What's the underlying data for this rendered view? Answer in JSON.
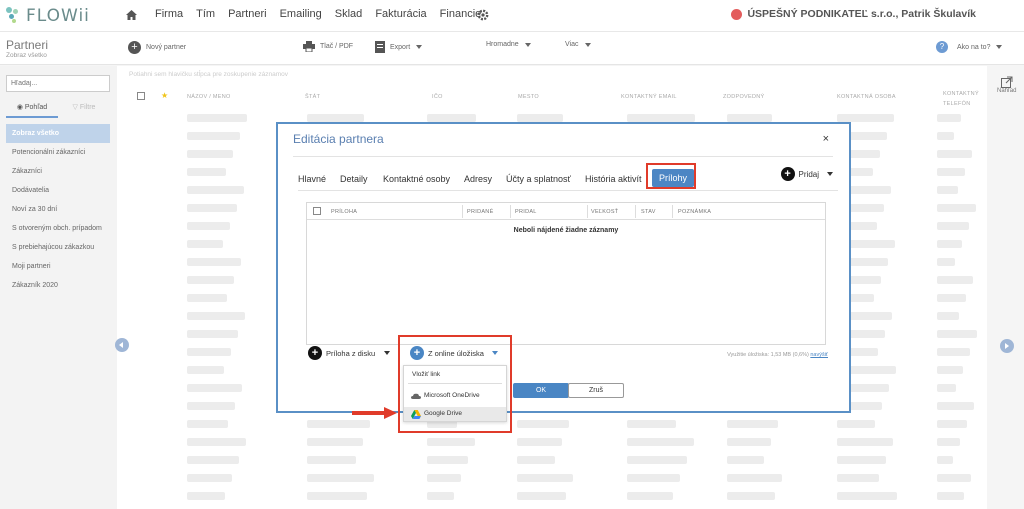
{
  "app": {
    "logo": "FLOWii"
  },
  "nav": [
    "Firma",
    "Tím",
    "Partneri",
    "Emailing",
    "Sklad",
    "Fakturácia",
    "Financie"
  ],
  "company": "ÚSPEŠNÝ PODNIKATEĽ s.r.o., Patrik Škulavík",
  "page": {
    "title": "Partneri",
    "subtitle": "Zobraz všetko"
  },
  "toolbar": {
    "new_partner": "Nový partner",
    "print": "Tlač / PDF",
    "export": "Export",
    "bulk": "Hromadne",
    "more": "Viac",
    "help": "Ako na to?"
  },
  "sidebar": {
    "search_placeholder": "Hľadaj...",
    "view_tab": "Pohľad",
    "filter_tab": "Filtre",
    "items": [
      "Zobraz všetko",
      "Potencionálni zákazníci",
      "Zákazníci",
      "Dodávatelia",
      "Noví za 30 dní",
      "S otvoreným obch. prípadom",
      "S prebiehajúcou zákazkou",
      "Moji partneri",
      "Zákazník 2020"
    ]
  },
  "list": {
    "hint": "Potiahni sem hlavičku stĺpca pre zoskupenie záznamov",
    "columns": [
      "NÁZOV / MENO",
      "ŠTÁT",
      "IČO",
      "MESTO",
      "KONTAKTNÝ EMAIL",
      "ZODPOVEDNÝ",
      "KONTAKTNÁ OSOBA",
      "KONTAKTNÝ TELEFÓN"
    ]
  },
  "preview": "Náhľad",
  "modal": {
    "title": "Editácia partnera",
    "close": "×",
    "tabs": [
      "Hlavné",
      "Detaily",
      "Kontaktné osoby",
      "Adresy",
      "Účty a splatnosť",
      "História aktivít",
      "Prílohy"
    ],
    "active_tab": "Prílohy",
    "add": "Pridaj",
    "grid_columns": [
      "PRÍLOHA",
      "PRIDANÉ",
      "PRIDAL",
      "VEĽKOSŤ",
      "STAV",
      "POZNÁMKA"
    ],
    "empty_message": "Neboli nájdené žiadne záznamy",
    "attach_from_disk": "Príloha z disku",
    "online_storage": "Z online úložiska",
    "storage_usage": "Využitie úložiska: 1,53 MB (0,6%)",
    "storage_link": "navýšiť",
    "ok": "OK",
    "cancel": "Zruš"
  },
  "dropdown": {
    "items": [
      "Vložiť link",
      "Microsoft OneDrive",
      "Google Drive"
    ]
  },
  "colors": {
    "accent": "#4a86c4",
    "highlight": "#e03b2a"
  }
}
